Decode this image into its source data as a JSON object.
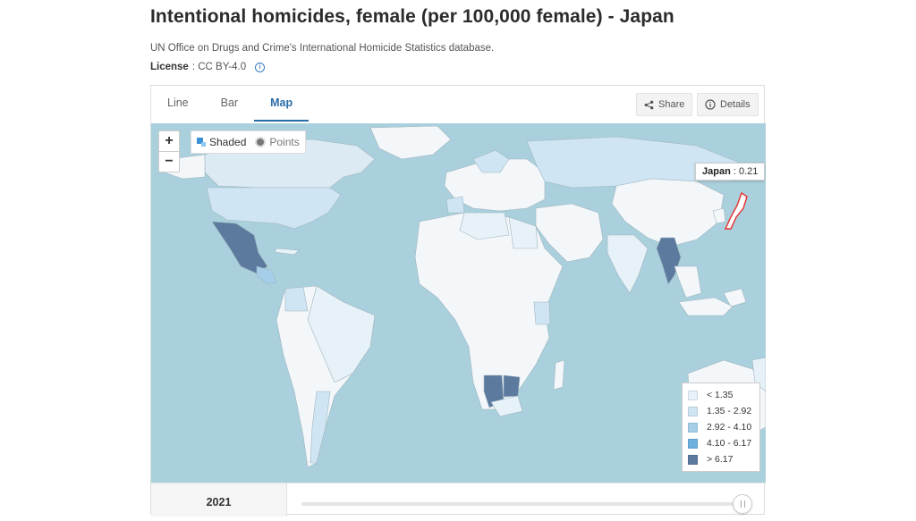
{
  "header": {
    "title": "Intentional homicides, female (per 100,000 female) - Japan",
    "source": "UN Office on Drugs and Crime's International Homicide Statistics database.",
    "license_label": "License",
    "license_value": ": CC BY-4.0"
  },
  "tabs": [
    {
      "label": "Line"
    },
    {
      "label": "Bar"
    },
    {
      "label": "Map",
      "active": true
    }
  ],
  "toolbar": {
    "share_label": "Share",
    "details_label": "Details"
  },
  "map": {
    "zoom_in": "+",
    "zoom_out": "−",
    "mode_shaded": "Shaded",
    "mode_points": "Points",
    "tooltip_country": "Japan",
    "tooltip_value": " : 0.21",
    "ocean_color": "#a9d0dc",
    "highlight_color": "#e8312f"
  },
  "legend": [
    {
      "label": "< 1.35",
      "color": "#e6f1f8"
    },
    {
      "label": "1.35 - 2.92",
      "color": "#cfe5f3"
    },
    {
      "label": "2.92 - 4.10",
      "color": "#a5cfe9"
    },
    {
      "label": "4.10 - 6.17",
      "color": "#6eb0e0"
    },
    {
      "label": "> 6.17",
      "color": "#5c7a9e"
    }
  ],
  "timeline": {
    "year": "2021"
  }
}
